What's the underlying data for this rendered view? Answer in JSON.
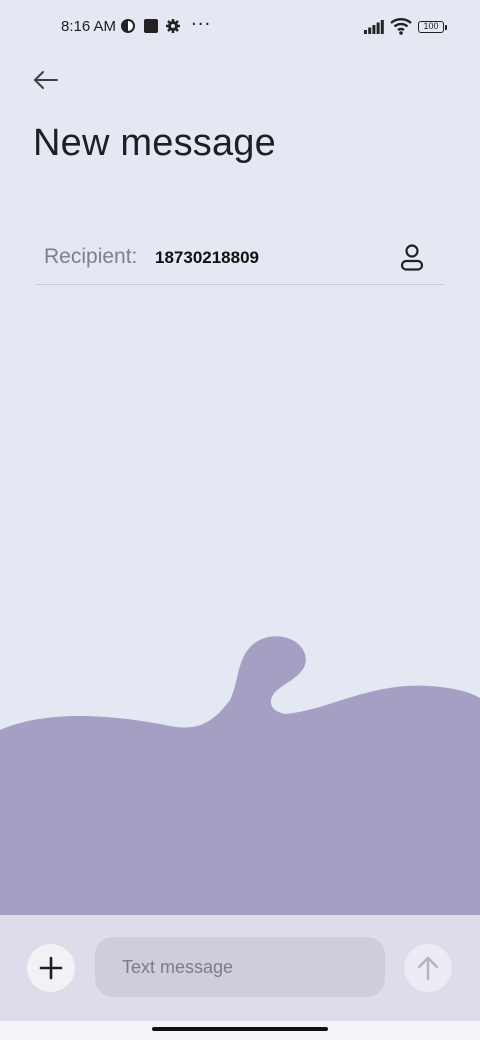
{
  "status_bar": {
    "time": "8:16 AM",
    "more": "···",
    "battery": "100"
  },
  "header": {
    "title": "New message"
  },
  "recipient": {
    "label": "Recipient:",
    "value": "18730218809"
  },
  "composer": {
    "placeholder": "Text message"
  },
  "icons": {
    "back": "arrow-left-icon",
    "contact": "person-icon",
    "add": "plus-icon",
    "send": "arrow-up-icon"
  },
  "colors": {
    "background": "#e4e8f2",
    "wave": "#a5a0c3",
    "composer_bar": "#dedbea",
    "input_fill": "#cfccdc"
  }
}
